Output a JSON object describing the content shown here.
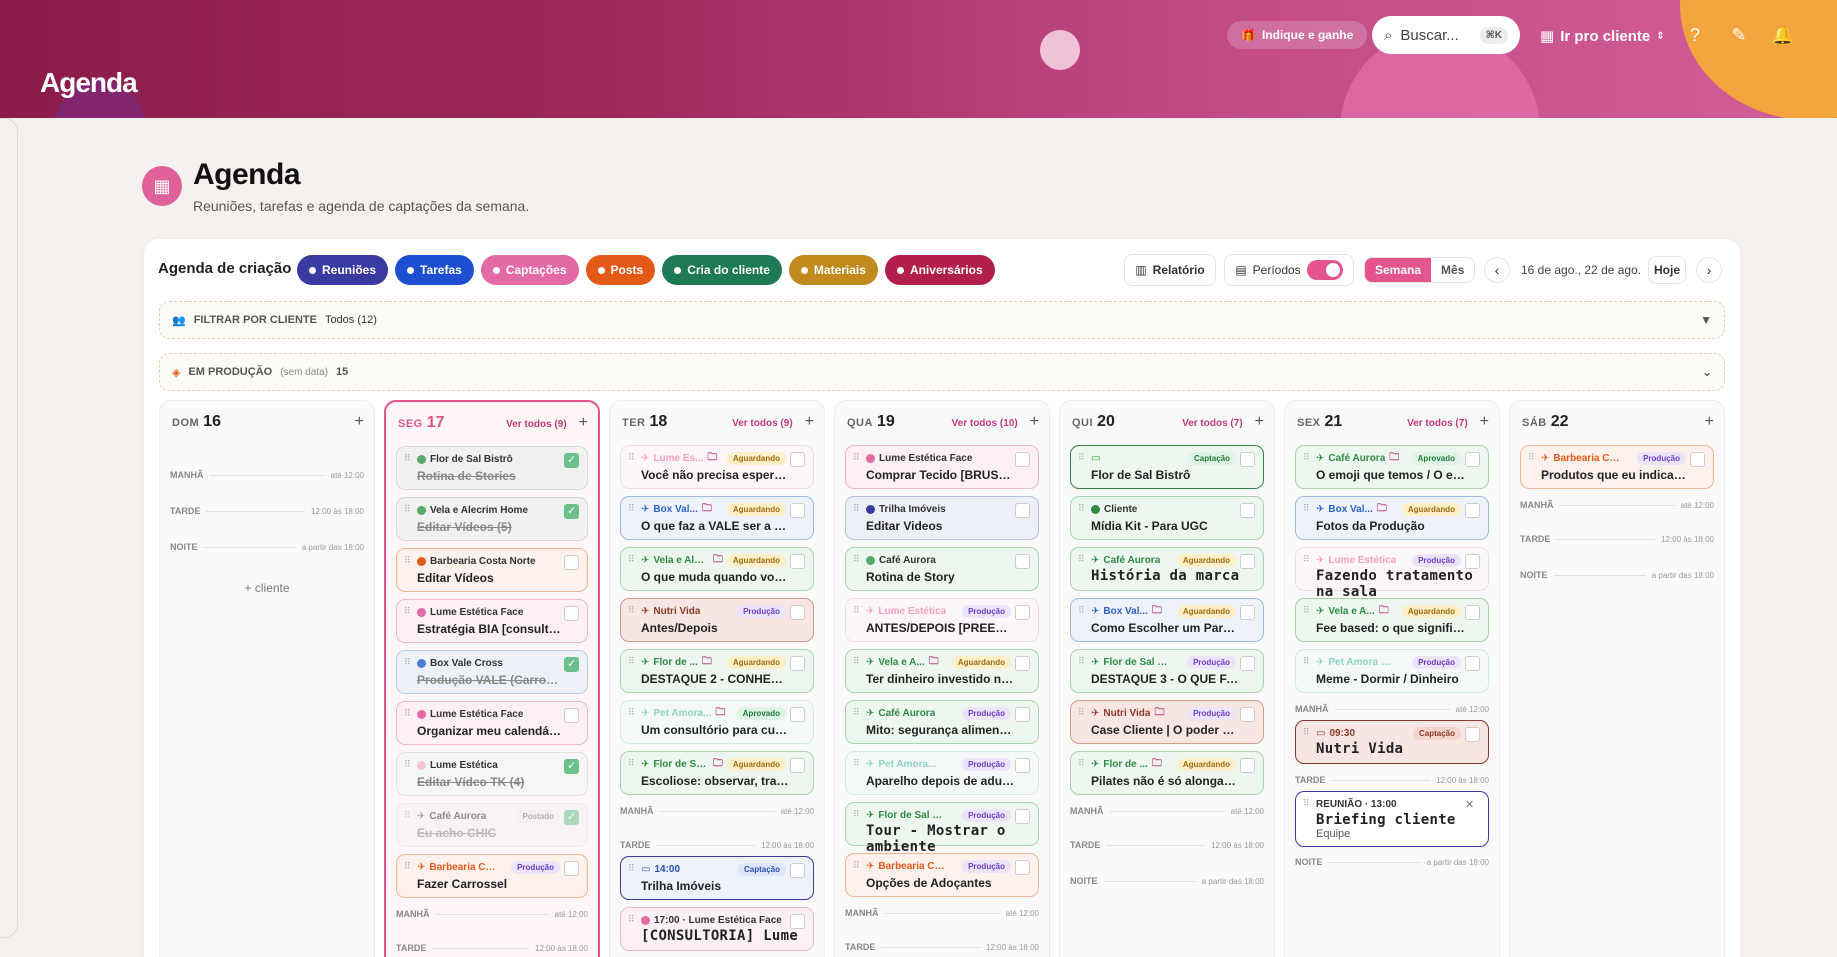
{
  "app": {
    "brand": "Agenda"
  },
  "topbar": {
    "refer_label": "Indique e ganhe",
    "search_placeholder": "Buscar...",
    "search_kbd": "⌘K",
    "client_switch": "Ir pro cliente"
  },
  "page": {
    "title": "Agenda",
    "subtitle": "Reuniões, tarefas e agenda de captações da semana."
  },
  "toolbar": {
    "title": "Agenda de criação",
    "chips": [
      {
        "label": "Reuniões",
        "color": "#3a3aa0"
      },
      {
        "label": "Tarefas",
        "color": "#1f4fd1"
      },
      {
        "label": "Captações",
        "color": "#e46aa6"
      },
      {
        "label": "Posts",
        "color": "#e35a18"
      },
      {
        "label": "Cria do cliente",
        "color": "#1d7a55"
      },
      {
        "label": "Materiais",
        "color": "#c08a1c"
      },
      {
        "label": "Aniversários",
        "color": "#b21f4c"
      }
    ],
    "report": "Relatório",
    "periods": "Períodos",
    "view_week": "Semana",
    "view_month": "Mês",
    "range": "16 de ago., 22 de ago.",
    "today": "Hoje"
  },
  "filter": {
    "label": "FILTRAR POR CLIENTE",
    "value": "Todos (12)"
  },
  "production": {
    "label": "EM PRODUÇÃO",
    "hint": "(sem data)",
    "count": "15"
  },
  "sections": {
    "morning": "MANHÃ",
    "afternoon": "TARDE",
    "night": "NOITE",
    "morning_t": "até 12:00",
    "afternoon_t": "12:00 às 18:00",
    "night_t": "a partir das 18:00"
  },
  "days": [
    {
      "dn": "DOM",
      "num": "16",
      "see_all": "",
      "add_client": "+ cliente",
      "events": []
    },
    {
      "dn": "SEG",
      "num": "17",
      "see_all": "Ver todos (9)",
      "events": [
        {
          "client": "Flor de Sal Bistrô",
          "title": "Rotina de Stories",
          "dot": "#5aa86a",
          "done": true,
          "bg": "#f1f1f1",
          "border": "#d7d7d7"
        },
        {
          "client": "Vela e Alecrim Home",
          "title": "Editar Vídeos (5)",
          "dot": "#5aa86a",
          "done": true,
          "bg": "#f1f1f1",
          "border": "#d7d7d7"
        },
        {
          "client": "Barbearia Costa Norte",
          "title": "Editar Vídeos",
          "dot": "#e35a18",
          "bg": "#fdf1ec",
          "border": "#f3b594"
        },
        {
          "client": "Lume Estética Face",
          "title": "Estratégia BIA [consultoria]",
          "dot": "#e46aa6",
          "bg": "#fdf0f5",
          "border": "#f0b6cf"
        },
        {
          "client": "Box Vale Cross",
          "title": "Produção VALE (Carrosséis) (5)",
          "dot": "#4a7fd0",
          "done": true,
          "bg": "#eef2f8",
          "border": "#b9c8e2"
        },
        {
          "client": "Lume Estética Face",
          "title": "Organizar meu calendário de c...",
          "dot": "#e46aa6",
          "bg": "#fdf0f5",
          "border": "#f0b6cf"
        },
        {
          "client": "Lume Estética",
          "title": "Editar Vídeo TK (4)",
          "dot": "#f4c6d9",
          "done": true,
          "bg": "#f6f6f6",
          "border": "#e2e2e2"
        },
        {
          "client": "Café Aurora",
          "title": "Eu acho CHIC",
          "icon": "✈",
          "badge": "Postado",
          "badge_bg": "#eee",
          "badge_fg": "#777",
          "done": true,
          "bg": "#f4f4f4",
          "border": "#e0e0e0",
          "faded": true
        },
        {
          "client": "Barbearia Cos...",
          "title": "Fazer Carrossel",
          "icon": "✈",
          "badge": "Produção",
          "badge_bg": "#ece4fb",
          "badge_fg": "#6a3fc9",
          "bg": "#fdf1ec",
          "border": "#f3b594",
          "fg": "#e35a18"
        }
      ]
    },
    {
      "dn": "TER",
      "num": "18",
      "see_all": "Ver todos (9)",
      "events": [
        {
          "client": "Lume Es...",
          "title": "Você não precisa esperar o se...",
          "icon": "✈",
          "folder": true,
          "badge": "Aguardando",
          "badge_bg": "#fdf0c8",
          "badge_fg": "#a06a10",
          "bg": "#fdf6f8",
          "border": "#f3dbe5",
          "fg": "#f4a0c2"
        },
        {
          "client": "Box Val...",
          "title": "O que faz a VALE ser a VALE",
          "icon": "✈",
          "folder": true,
          "badge": "Aguardando",
          "badge_bg": "#fdf0c8",
          "badge_fg": "#a06a10",
          "bg": "#eef3fb",
          "border": "#9fb8e4",
          "fg": "#2b63c6"
        },
        {
          "client": "Vela e Alecr...",
          "title": "O que muda quando você deix...",
          "icon": "✈",
          "folder": true,
          "badge": "Aguardando",
          "badge_bg": "#fdf0c8",
          "badge_fg": "#a06a10",
          "bg": "#eef7ef",
          "border": "#a9d3b0",
          "fg": "#2f8a45"
        },
        {
          "client": "Nutri Vida",
          "title": "Antes/Depois",
          "icon": "✈",
          "badge": "Produção",
          "badge_bg": "#ece4fb",
          "badge_fg": "#6a3fc9",
          "bg": "#f7e6e1",
          "border": "#cf9d90",
          "fg": "#8a3a2a"
        },
        {
          "client": "Flor de ...",
          "title": "DESTAQUE 2 - CONHEÇA A LO...",
          "icon": "✈",
          "folder": true,
          "badge": "Aguardando",
          "badge_bg": "#fdf0c8",
          "badge_fg": "#a06a10",
          "bg": "#eef7ef",
          "border": "#a9d3b0",
          "fg": "#2f8a45"
        },
        {
          "client": "Pet Amora...",
          "title": "Um consultório para cuidar do ...",
          "icon": "✈",
          "folder": true,
          "badge": "Aprovado",
          "badge_bg": "#dff4e4",
          "badge_fg": "#237a3c",
          "bg": "#f4f9f7",
          "border": "#d4ebe0",
          "fg": "#8ed3c4"
        },
        {
          "client": "Flor de Sal ...",
          "title": "Escoliose: observar, tratar ou o...",
          "icon": "✈",
          "folder": true,
          "badge": "Aguardando",
          "badge_bg": "#fdf0c8",
          "badge_fg": "#a06a10",
          "bg": "#eef7ef",
          "border": "#a9d3b0",
          "fg": "#2f8a45"
        },
        {
          "client": "14:00",
          "title": "Trilha Imóveis",
          "icon": "▭",
          "badge": "Captação",
          "badge_bg": "#dfe6fb",
          "badge_fg": "#2b4fb0",
          "bg": "#eef2fb",
          "border": "#3a3aa0",
          "fg": "#2b4fb0"
        },
        {
          "client": "17:00 · Lume Estética Face",
          "title": "[CONSULTORIA] Lume",
          "dot": "#e46aa6",
          "big": true,
          "bg": "#fdf0f5",
          "border": "#f0b6cf"
        }
      ]
    },
    {
      "dn": "QUA",
      "num": "19",
      "see_all": "Ver todos (10)",
      "events": [
        {
          "client": "Lume Estética Face",
          "title": "Comprar Tecido [BRUSQUE]",
          "dot": "#e46aa6",
          "bg": "#fdf0f5",
          "border": "#f0b6cf"
        },
        {
          "client": "Trilha Imóveis",
          "title": "Editar Videos",
          "dot": "#3a3aa0",
          "bg": "#eef0f8",
          "border": "#b6bfe0"
        },
        {
          "client": "Café Aurora",
          "title": "Rotina de Story",
          "dot": "#5aa86a",
          "bg": "#eef7ef",
          "border": "#a9d3b0"
        },
        {
          "client": "Lume Estética",
          "title": "ANTES/DEPOIS [PREENCHIME...",
          "icon": "✈",
          "badge": "Produção",
          "badge_bg": "#ece4fb",
          "badge_fg": "#6a3fc9",
          "bg": "#fdf6f8",
          "border": "#f3dbe5",
          "fg": "#f4a0c2"
        },
        {
          "client": "Vela e A...",
          "title": "Ter dinheiro investido não sign...",
          "icon": "✈",
          "folder": true,
          "badge": "Aguardando",
          "badge_bg": "#fdf0c8",
          "badge_fg": "#a06a10",
          "bg": "#eef7ef",
          "border": "#a9d3b0",
          "fg": "#2f8a45"
        },
        {
          "client": "Café Aurora",
          "title": "Mito: segurança alimentar é só...",
          "icon": "✈",
          "badge": "Produção",
          "badge_bg": "#ece4fb",
          "badge_fg": "#6a3fc9",
          "bg": "#eef7ef",
          "border": "#a9d3b0",
          "fg": "#2f8a45"
        },
        {
          "client": "Pet Amora...",
          "title": "Aparelho depois de adulto: ain...",
          "icon": "✈",
          "badge": "Produção",
          "badge_bg": "#ece4fb",
          "badge_fg": "#6a3fc9",
          "bg": "#f4f9f7",
          "border": "#d4ebe0",
          "fg": "#8ed3c4"
        },
        {
          "client": "Flor de Sal Bis...",
          "title": "Tour - Mostrar o ambiente",
          "icon": "✈",
          "badge": "Produção",
          "badge_bg": "#ece4fb",
          "badge_fg": "#6a3fc9",
          "big": true,
          "bg": "#eef7ef",
          "border": "#a9d3b0",
          "fg": "#2f8a45"
        },
        {
          "client": "Barbearia Cos...",
          "title": "Opções de Adoçantes",
          "icon": "✈",
          "badge": "Produção",
          "badge_bg": "#ece4fb",
          "badge_fg": "#6a3fc9",
          "bg": "#fdf1ec",
          "border": "#f3b594",
          "fg": "#e35a18"
        }
      ]
    },
    {
      "dn": "QUI",
      "num": "20",
      "see_all": "Ver todos (7)",
      "events": [
        {
          "client": "",
          "title": "Flor de Sal Bistrô",
          "icon": "▭",
          "badge": "Captação",
          "badge_bg": "#dff4e4",
          "badge_fg": "#237a3c",
          "bg": "#eef7ef",
          "border": "#2f8a45",
          "fg": "#2f8a45"
        },
        {
          "client": "Cliente",
          "title": "Mídia Kit - Para UGC",
          "dot": "#2f8a45",
          "bg": "#eef7ef",
          "border": "#a9d3b0"
        },
        {
          "client": "Café Aurora",
          "title": "História da marca",
          "icon": "✈",
          "badge": "Aguardando",
          "badge_bg": "#fdf0c8",
          "badge_fg": "#a06a10",
          "big": true,
          "bg": "#eef7ef",
          "border": "#a9d3b0",
          "fg": "#2f8a45"
        },
        {
          "client": "Box Val...",
          "title": "Como Escolher um Parceiro de...",
          "icon": "✈",
          "folder": true,
          "badge": "Aguardando",
          "badge_bg": "#fdf0c8",
          "badge_fg": "#a06a10",
          "bg": "#eef3fb",
          "border": "#9fb8e4",
          "fg": "#2b63c6"
        },
        {
          "client": "Flor de Sal Bis...",
          "title": "DESTAQUE 3 - O QUE FAZEMOS",
          "icon": "✈",
          "badge": "Produção",
          "badge_bg": "#ece4fb",
          "badge_fg": "#6a3fc9",
          "bg": "#eef7ef",
          "border": "#a9d3b0",
          "fg": "#2f8a45"
        },
        {
          "client": "Nutri Vida",
          "title": "Case Cliente | O poder do plan...",
          "icon": "✈",
          "folder": true,
          "badge": "Produção",
          "badge_bg": "#ece4fb",
          "badge_fg": "#6a3fc9",
          "bg": "#f7e6e1",
          "border": "#cf9d90",
          "fg": "#8a3a2a"
        },
        {
          "client": "Flor de ...",
          "title": "Pilates não é só alongamento: ...",
          "icon": "✈",
          "folder": true,
          "badge": "Aguardando",
          "badge_bg": "#fdf0c8",
          "badge_fg": "#a06a10",
          "bg": "#eef7ef",
          "border": "#a9d3b0",
          "fg": "#2f8a45"
        }
      ]
    },
    {
      "dn": "SEX",
      "num": "21",
      "see_all": "Ver todos (7)",
      "events": [
        {
          "client": "Café Aurora",
          "title": "O emoji que temos / O emoji q...",
          "icon": "✈",
          "folder": true,
          "badge": "Aprovado",
          "badge_bg": "#dff4e4",
          "badge_fg": "#237a3c",
          "bg": "#eef7ef",
          "border": "#a9d3b0",
          "fg": "#2f8a45"
        },
        {
          "client": "Box Val...",
          "title": "Fotos da Produção",
          "icon": "✈",
          "folder": true,
          "badge": "Aguardando",
          "badge_bg": "#fdf0c8",
          "badge_fg": "#a06a10",
          "bg": "#eef3fb",
          "border": "#9fb8e4",
          "fg": "#2b63c6"
        },
        {
          "client": "Lume Estética",
          "title": "Fazendo tratamento na sala",
          "icon": "✈",
          "badge": "Produção",
          "badge_bg": "#ece4fb",
          "badge_fg": "#6a3fc9",
          "big": true,
          "bg": "#fdf6f8",
          "border": "#f3dbe5",
          "fg": "#f4a0c2"
        },
        {
          "client": "Vela e A...",
          "title": "Fee based: o que significa na p...",
          "icon": "✈",
          "folder": true,
          "badge": "Aguardando",
          "badge_bg": "#fdf0c8",
          "badge_fg": "#a06a10",
          "bg": "#eef7ef",
          "border": "#a9d3b0",
          "fg": "#2f8a45"
        },
        {
          "client": "Pet Amora Cli...",
          "title": "Meme - Dormir / Dinheiro",
          "icon": "✈",
          "badge": "Produção",
          "badge_bg": "#ece4fb",
          "badge_fg": "#6a3fc9",
          "bg": "#f4f9f7",
          "border": "#d4ebe0",
          "fg": "#8ed3c4"
        },
        {
          "client": "09:30",
          "title": "Nutri Vida",
          "icon": "▭",
          "badge": "Captação",
          "badge_bg": "#f5d6cf",
          "badge_fg": "#8a3a2a",
          "big": true,
          "bg": "#f7e6e1",
          "border": "#8a3a2a",
          "fg": "#8a3a2a"
        },
        {
          "client": "REUNIÃO · 13:00",
          "title": "Briefing cliente",
          "sub": "Equipe",
          "big": true,
          "bg": "#fff",
          "border": "#3a3aa0",
          "fg": "#3a3aa0"
        }
      ]
    },
    {
      "dn": "SÁB",
      "num": "22",
      "see_all": "",
      "events": [
        {
          "client": "Barbearia Cos...",
          "title": "Produtos que eu indicaria para ...",
          "icon": "✈",
          "badge": "Produção",
          "badge_bg": "#ece4fb",
          "badge_fg": "#6a3fc9",
          "bg": "#fdf1ec",
          "border": "#f3b594",
          "fg": "#e35a18"
        }
      ]
    }
  ]
}
